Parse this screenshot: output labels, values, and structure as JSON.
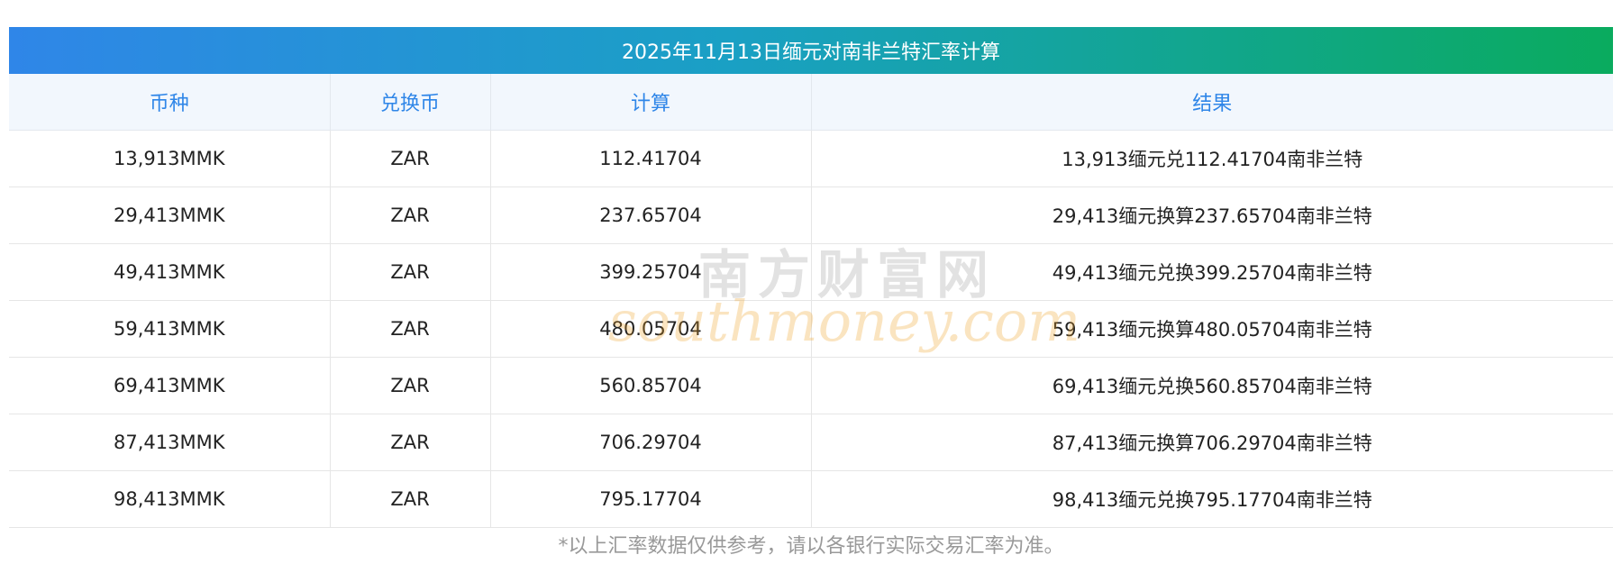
{
  "table": {
    "title": "2025年11月13日缅元对南非兰特汇率计算",
    "headers": [
      "币种",
      "兑换币",
      "计算",
      "结果"
    ],
    "rows": [
      {
        "amount": "13,913MMK",
        "currency": "ZAR",
        "calc": "112.41704",
        "result": "13,913缅元兑112.41704南非兰特"
      },
      {
        "amount": "29,413MMK",
        "currency": "ZAR",
        "calc": "237.65704",
        "result": "29,413缅元换算237.65704南非兰特"
      },
      {
        "amount": "49,413MMK",
        "currency": "ZAR",
        "calc": "399.25704",
        "result": "49,413缅元兑换399.25704南非兰特"
      },
      {
        "amount": "59,413MMK",
        "currency": "ZAR",
        "calc": "480.05704",
        "result": "59,413缅元换算480.05704南非兰特"
      },
      {
        "amount": "69,413MMK",
        "currency": "ZAR",
        "calc": "560.85704",
        "result": "69,413缅元兑换560.85704南非兰特"
      },
      {
        "amount": "87,413MMK",
        "currency": "ZAR",
        "calc": "706.29704",
        "result": "87,413缅元换算706.29704南非兰特"
      },
      {
        "amount": "98,413MMK",
        "currency": "ZAR",
        "calc": "795.17704",
        "result": "98,413缅元兑换795.17704南非兰特"
      }
    ]
  },
  "watermark": {
    "cn": "南方财富网",
    "en": "southmoney.com"
  },
  "footnote": "*以上汇率数据仅供参考，请以各银行实际交易汇率为准。",
  "colors": {
    "title_gradient_start": "#2f86e8",
    "title_gradient_end": "#0aab5e",
    "header_text": "#2f86e8",
    "header_bg": "#f2f7fd"
  }
}
